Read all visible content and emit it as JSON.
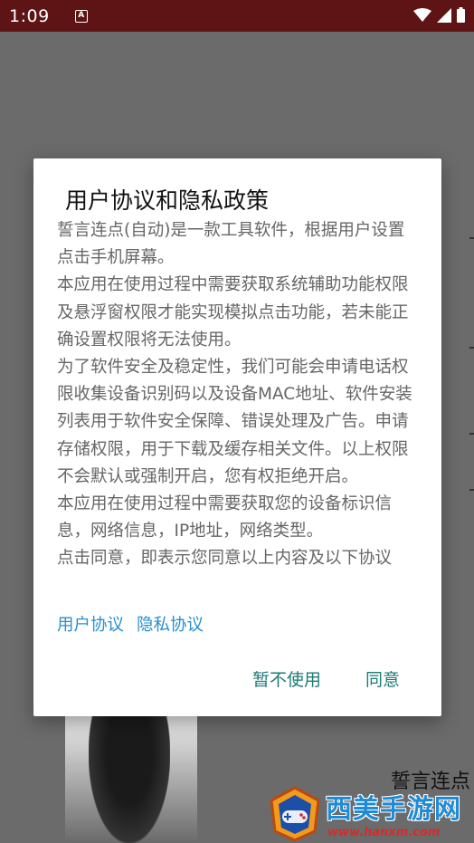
{
  "status_bar": {
    "time": "1:09",
    "notification_icon": "A"
  },
  "background": {
    "app_title": "誓言连点"
  },
  "dialog": {
    "title": "用户协议和隐私政策",
    "paragraphs": [
      "誓言连点(自动)是一款工具软件，根据用户设置点击手机屏幕。",
      "本应用在使用过程中需要获取系统辅助功能权限及悬浮窗权限才能实现模拟点击功能，若未能正确设置权限将无法使用。",
      "为了软件安全及稳定性，我们可能会申请电话权限收集设备识别码以及设备MAC地址、软件安装列表用于软件安全保障、错误处理及广告。申请存储权限，用于下载及缓存相关文件。以上权限不会默认或强制开启，您有权拒绝开启。",
      "本应用在使用过程中需要获取您的设备标识信息，网络信息，IP地址，网络类型。",
      "点击同意，即表示您同意以上内容及以下协议"
    ],
    "user_agreement_link": "用户协议",
    "privacy_policy_link": "隐私协议",
    "cancel_button": "暂不使用",
    "agree_button": "同意"
  },
  "watermark": {
    "brand": "西美手游网",
    "url": "www.hanxm.com"
  },
  "colors": {
    "status_bar": "#5e1414",
    "overlay": "#6b6b6b",
    "link": "#2a8fcc",
    "action": "#1e7a75"
  }
}
